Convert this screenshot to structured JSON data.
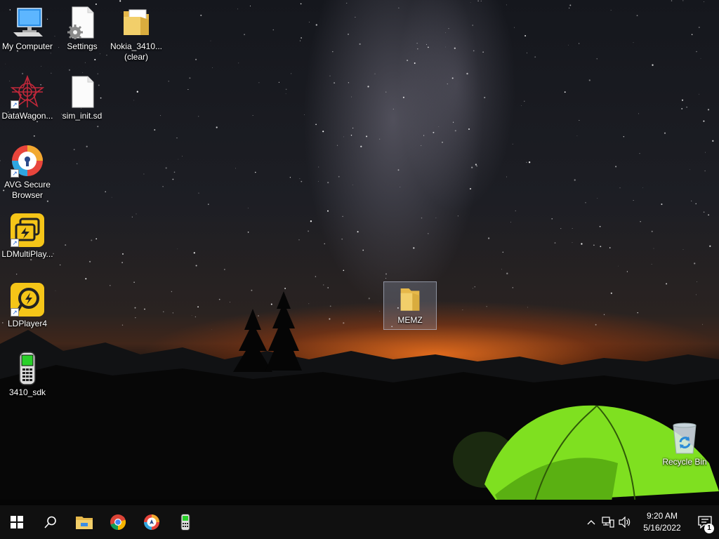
{
  "desktop": {
    "icons": [
      {
        "label": "My Computer",
        "icon": "computer-icon"
      },
      {
        "label": "Settings",
        "icon": "settings-file-icon"
      },
      {
        "label": "Nokia_3410...\n(clear)",
        "icon": "folder-icon"
      },
      {
        "label": "DataWagon...",
        "icon": "datawagon-icon"
      },
      {
        "label": "sim_init.sd",
        "icon": "blank-file-icon"
      },
      {
        "label": "AVG Secure\nBrowser",
        "icon": "avg-browser-icon"
      },
      {
        "label": "LDMultiPlay...",
        "icon": "ldmultiplayer-icon"
      },
      {
        "label": "LDPlayer4",
        "icon": "ldplayer-icon"
      },
      {
        "label": "3410_sdk",
        "icon": "nokia-phone-icon"
      },
      {
        "label": "MEMZ",
        "icon": "folder-icon",
        "selected": true
      },
      {
        "label": "Recycle Bin",
        "icon": "recycle-bin-icon"
      }
    ]
  },
  "taskbar": {
    "pinned": [
      "windows-start-icon",
      "search-icon",
      "file-explorer-icon",
      "chrome-icon",
      "avg-browser-icon",
      "nokia-phone-icon"
    ],
    "tray": {
      "time": "9:20 AM",
      "date": "5/16/2022",
      "notification_count": "1"
    }
  },
  "colors": {
    "taskbar": "#101010",
    "tent": "#7fe020",
    "sunset": "#ff7a1e",
    "folder": "#f2cf6a"
  }
}
